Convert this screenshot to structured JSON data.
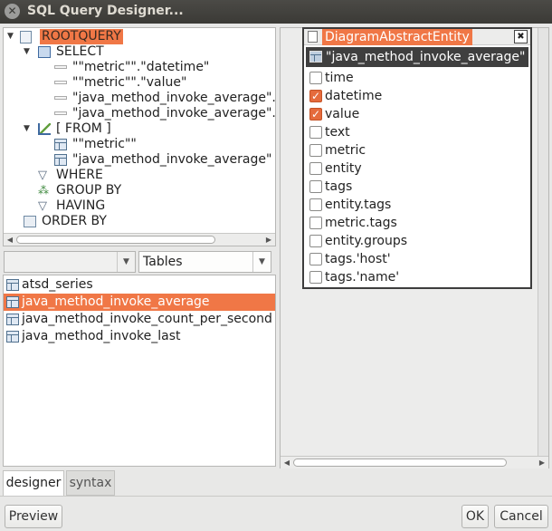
{
  "window": {
    "title": "SQL Query Designer..."
  },
  "tree": {
    "root": "ROOTQUERY",
    "select": "SELECT",
    "select_items": [
      "\"\"metric\"\".\"datetime\"",
      "\"\"metric\"\".\"value\"",
      "\"java_method_invoke_average\".\"",
      "\"java_method_invoke_average\".\""
    ],
    "from": "[ FROM ]",
    "from_items": [
      "\"\"metric\"\"",
      "\"java_method_invoke_average\""
    ],
    "where": "WHERE",
    "group_by": "GROUP BY",
    "having": "HAVING",
    "order_by": "ORDER BY"
  },
  "source": {
    "selected": "Tables"
  },
  "tables": [
    "atsd_series",
    "java_method_invoke_average",
    "java_method_invoke_count_per_second",
    "java_method_invoke_last"
  ],
  "entity_box": {
    "title": "DiagramAbstractEntity",
    "close": "✖",
    "table": "\"java_method_invoke_average\"",
    "columns": [
      {
        "name": "time",
        "checked": false
      },
      {
        "name": "datetime",
        "checked": true
      },
      {
        "name": "value",
        "checked": true
      },
      {
        "name": "text",
        "checked": false
      },
      {
        "name": "metric",
        "checked": false
      },
      {
        "name": "entity",
        "checked": false
      },
      {
        "name": "tags",
        "checked": false
      },
      {
        "name": "entity.tags",
        "checked": false
      },
      {
        "name": "metric.tags",
        "checked": false
      },
      {
        "name": "entity.groups",
        "checked": false
      },
      {
        "name": "tags.'host'",
        "checked": false
      },
      {
        "name": "tags.'name'",
        "checked": false
      }
    ]
  },
  "tabs": {
    "designer": "designer",
    "syntax": "syntax"
  },
  "buttons": {
    "preview": "Preview",
    "ok": "OK",
    "cancel": "Cancel"
  },
  "colors": {
    "accent": "#f07746",
    "title_bg": "#3f3e3a"
  }
}
